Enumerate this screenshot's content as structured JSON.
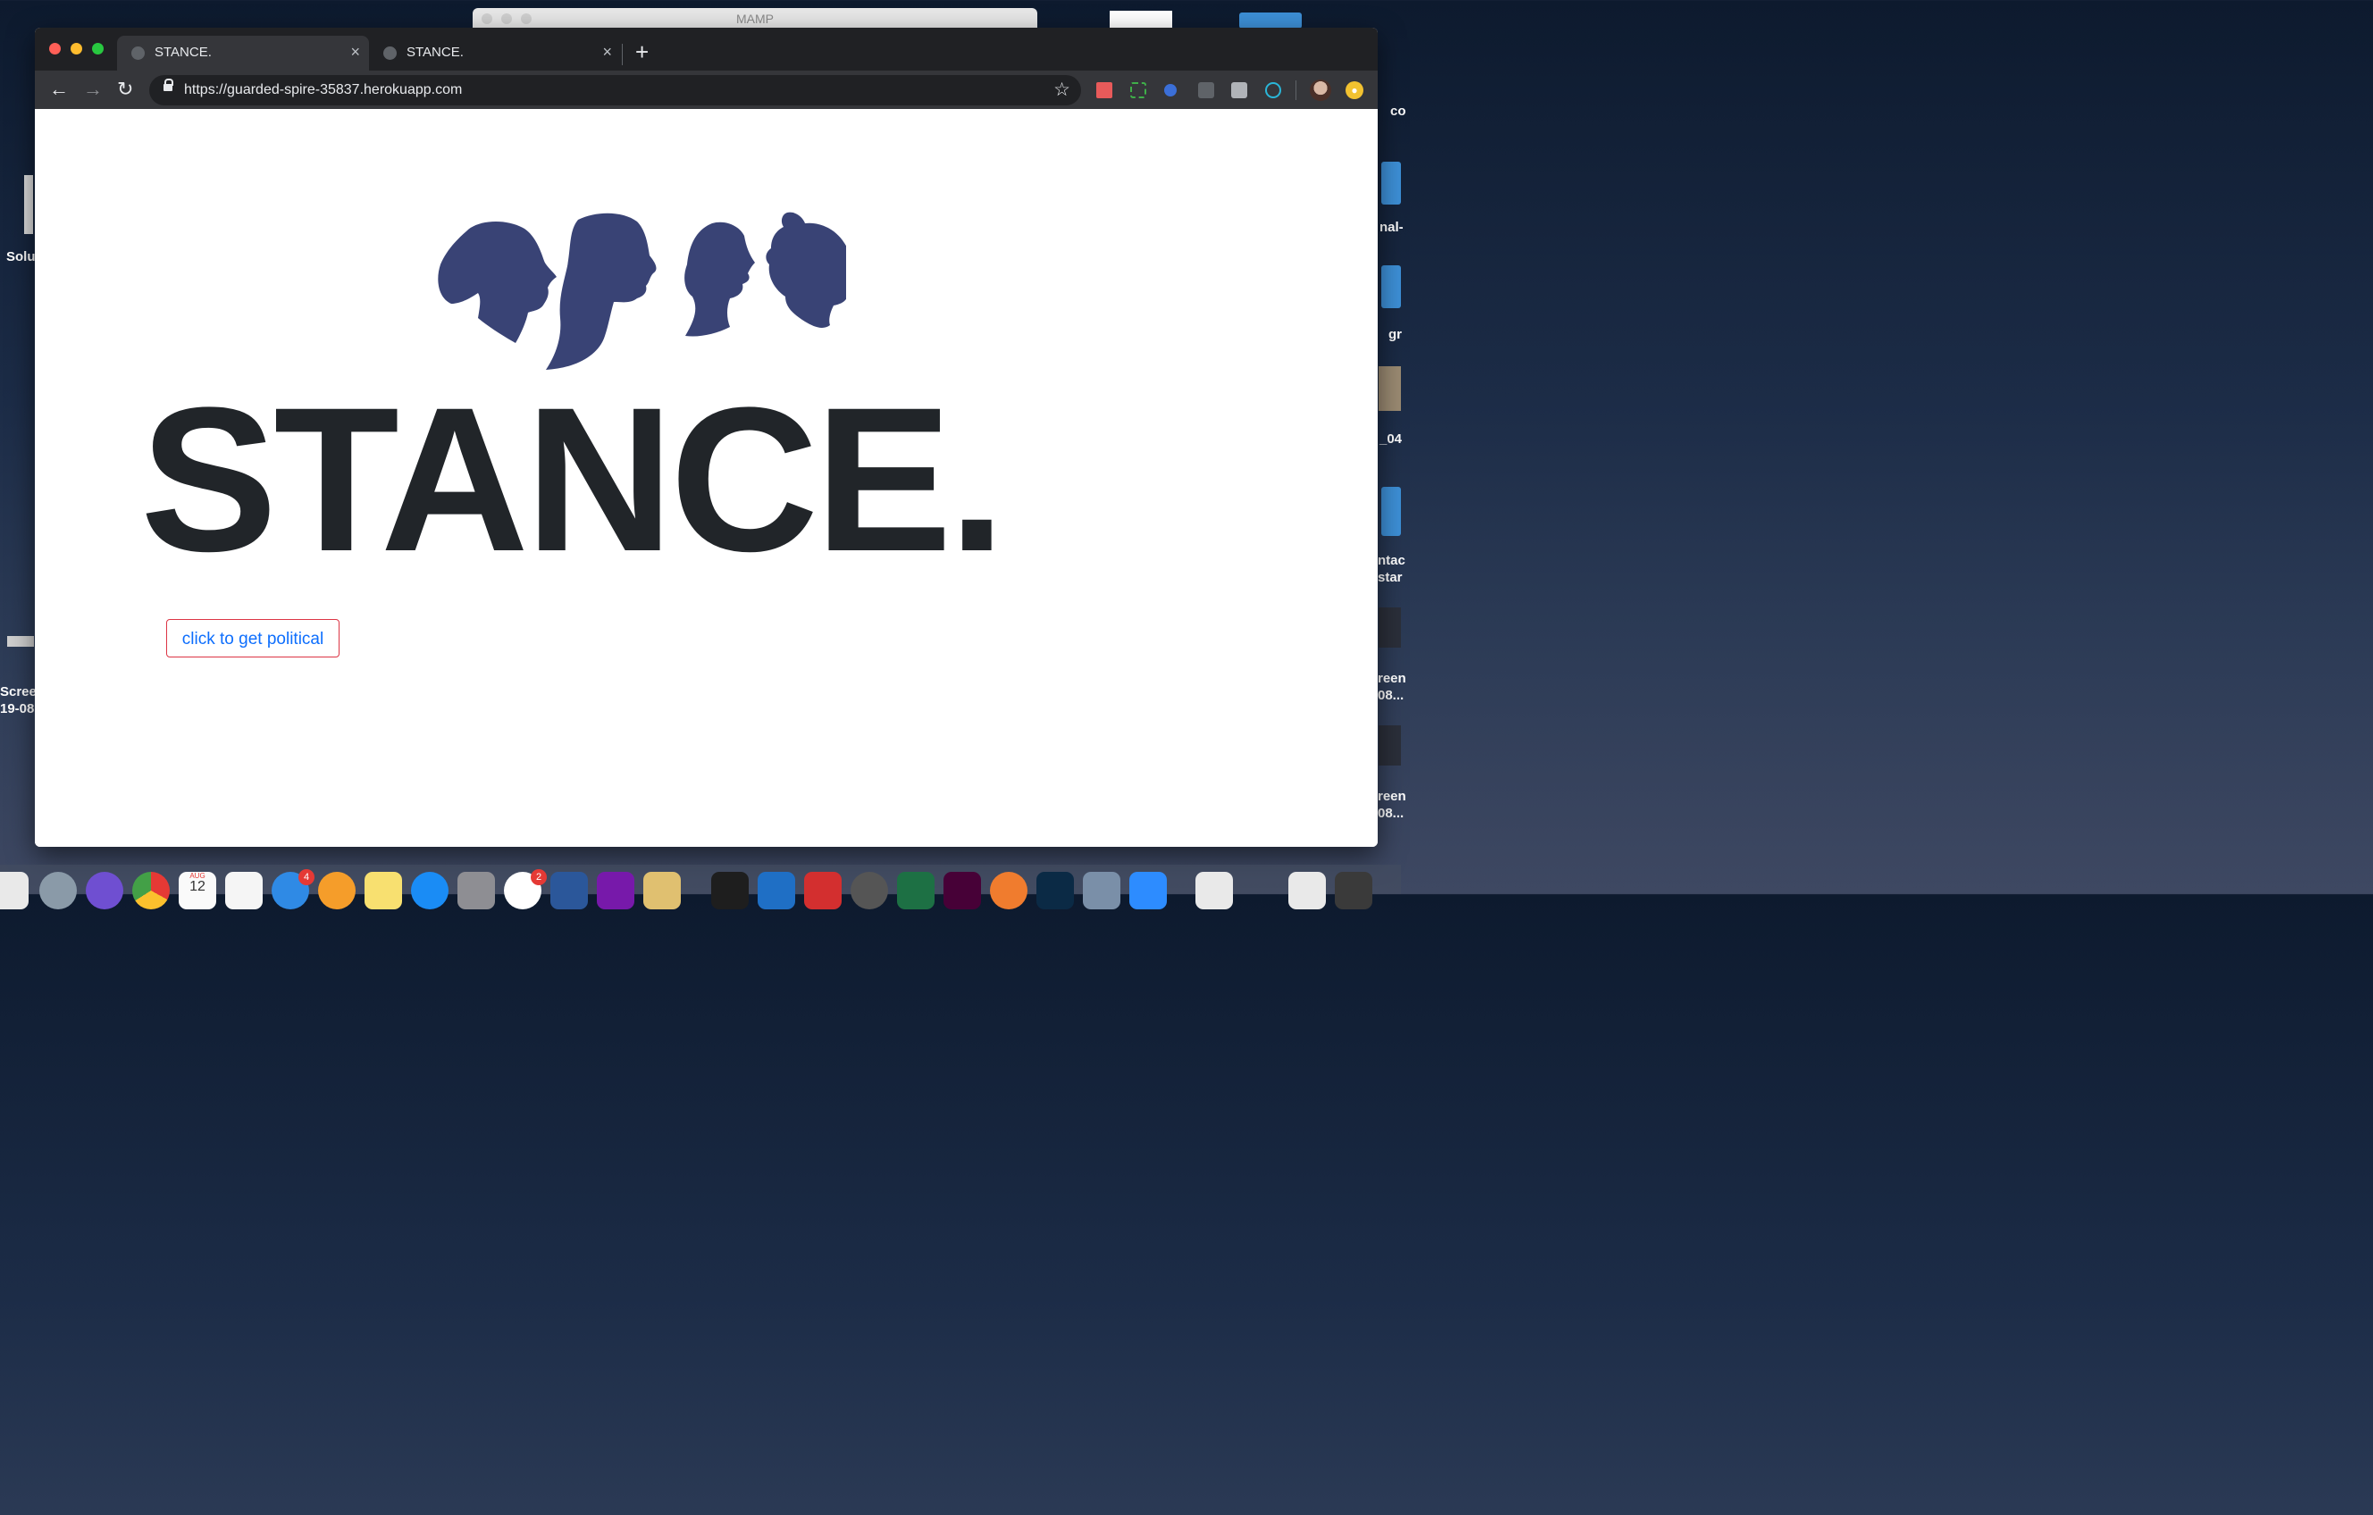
{
  "desktop": {
    "mamp_title": "MAMP",
    "items": [
      "Solu",
      "Scree",
      "19-08",
      "co",
      "nal-",
      "gr",
      "_04",
      "ntac",
      "star",
      "reen",
      "08...",
      "reen",
      "08..."
    ]
  },
  "browser": {
    "tabs": [
      {
        "label": "STANCE.",
        "close": "×"
      },
      {
        "label": "STANCE.",
        "close": "×"
      }
    ],
    "new_tab": "+",
    "url": "https://guarded-spire-35837.herokuapp.com",
    "nav": {
      "back": "←",
      "forward": "→",
      "reload": "↻",
      "bookmark": "☆"
    }
  },
  "page": {
    "brand": "STANCE.",
    "cta_label": "click to get political",
    "colors": {
      "silhouette": "#394375",
      "brand_text": "#212529",
      "button_border": "#dc3545",
      "button_text": "#0d6efd"
    }
  },
  "dock": {
    "badges": {
      "mail": "4",
      "slack": "2"
    },
    "calendar_month": "AUG",
    "calendar_day": "12"
  }
}
